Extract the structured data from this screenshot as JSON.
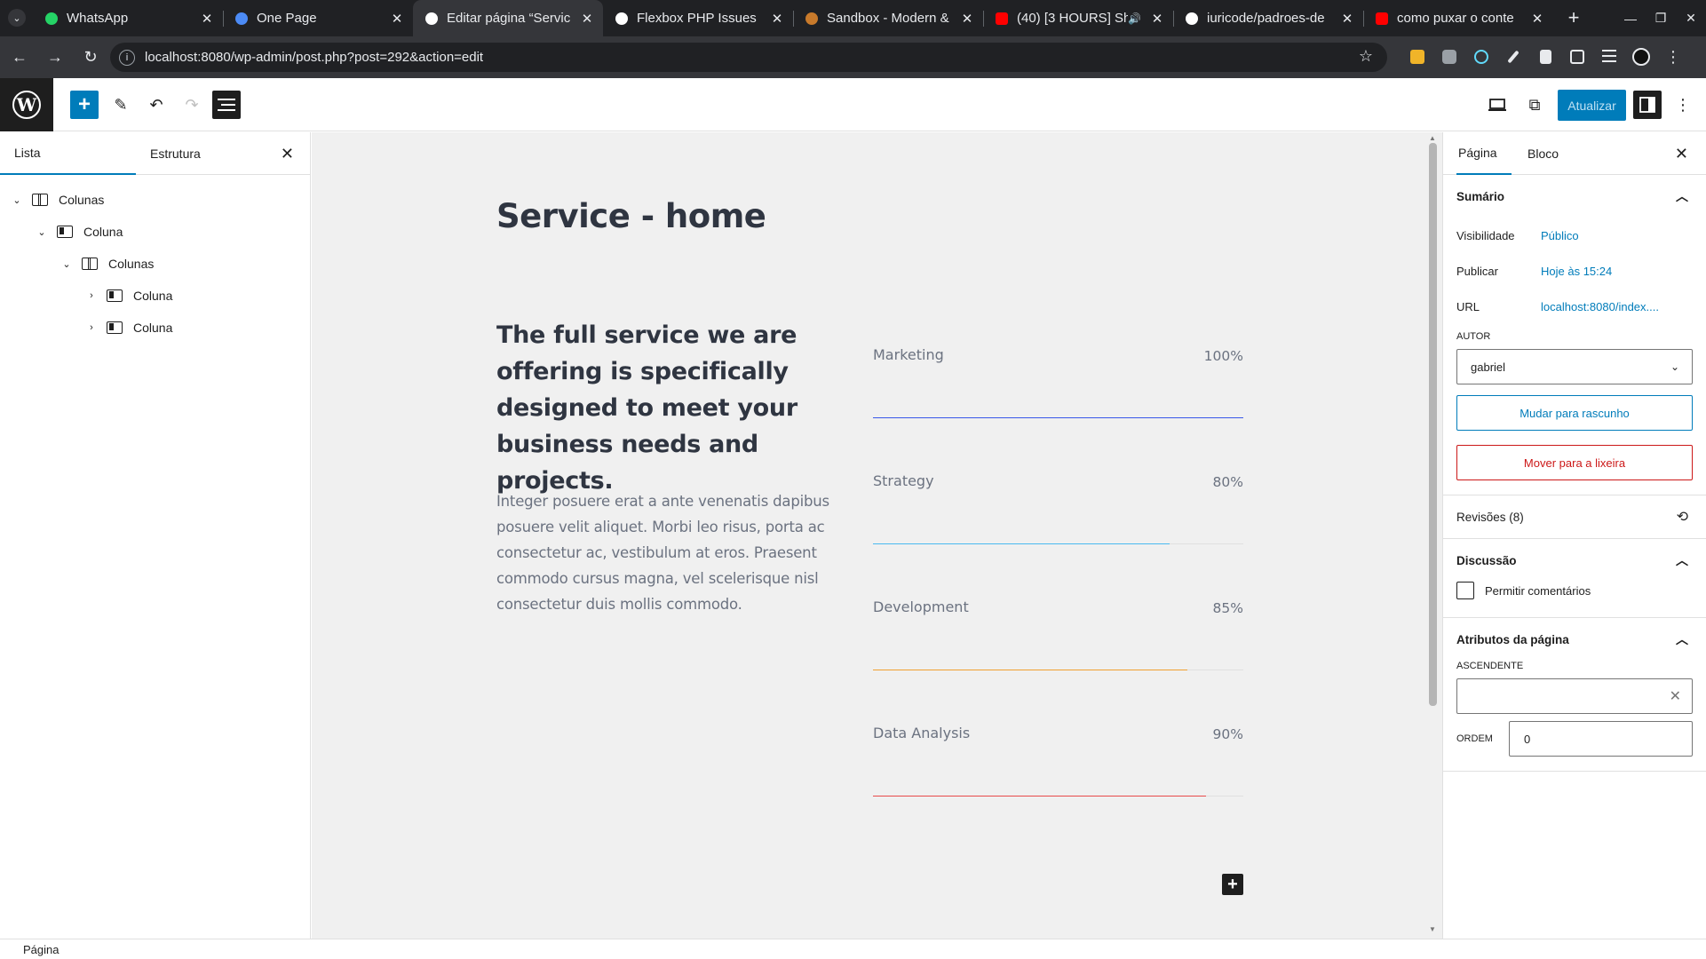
{
  "browser": {
    "tabs": [
      {
        "title": "WhatsApp",
        "icon": "whatsapp-icon",
        "color": "#25d366"
      },
      {
        "title": "One Page",
        "icon": "page-icon",
        "color": "#4c8bf5"
      },
      {
        "title": "Editar página “Servic",
        "icon": "wordpress-icon",
        "color": "#ffffff"
      },
      {
        "title": "Flexbox PHP Issues",
        "icon": "openai-icon",
        "color": "#ffffff"
      },
      {
        "title": "Sandbox - Modern &",
        "icon": "bookmark-icon",
        "color": "#c87a2b"
      },
      {
        "title": "(40) [3 HOURS] Sh",
        "icon": "youtube-icon",
        "color": "#ff0000"
      },
      {
        "title": "iuricode/padroes-de",
        "icon": "github-icon",
        "color": "#ffffff"
      },
      {
        "title": "como puxar o conte",
        "icon": "youtube-icon",
        "color": "#ff0000"
      }
    ],
    "url": "localhost:8080/wp-admin/post.php?post=292&action=edit"
  },
  "editor": {
    "update_label": "Atualizar"
  },
  "list_view": {
    "tabs": [
      "Lista",
      "Estrutura"
    ],
    "items": [
      {
        "label": "Colunas",
        "type": "cols",
        "chevron": "⌄",
        "indent": 0
      },
      {
        "label": "Coluna",
        "type": "col",
        "chevron": "⌄",
        "indent": 1
      },
      {
        "label": "Colunas",
        "type": "cols",
        "chevron": "⌄",
        "indent": 2
      },
      {
        "label": "Coluna",
        "type": "col",
        "chevron": "›",
        "indent": 3
      },
      {
        "label": "Coluna",
        "type": "col",
        "chevron": "›",
        "indent": 3
      }
    ]
  },
  "canvas": {
    "title": "Service - home",
    "lead": "The full service we are offering is specifically designed to meet your business needs and projects.",
    "body": "Integer posuere erat a ante venenatis dapibus posuere velit aliquet. Morbi leo risus, porta ac consectetur ac, vestibulum at eros. Praesent commodo cursus magna, vel scelerisque nisl consectetur duis mollis commodo.",
    "skills": [
      {
        "name": "Marketing",
        "percent_label": "100%",
        "value": 100,
        "color": "#3858e9"
      },
      {
        "name": "Strategy",
        "percent_label": "80%",
        "value": 80,
        "color": "#4ab9f0"
      },
      {
        "name": "Development",
        "percent_label": "85%",
        "value": 85,
        "color": "#f0a030"
      },
      {
        "name": "Data Analysis",
        "percent_label": "90%",
        "value": 90,
        "color": "#e84a4a"
      }
    ]
  },
  "sidebar": {
    "tabs": [
      "Página",
      "Bloco"
    ],
    "summary": {
      "heading": "Sumário",
      "visibility_label": "Visibilidade",
      "visibility_value": "Público",
      "publish_label": "Publicar",
      "publish_value": "Hoje às 15:24",
      "url_label": "URL",
      "url_value": "localhost:8080/index....",
      "author_label": "AUTOR",
      "author_value": "gabriel",
      "draft_button": "Mudar para rascunho",
      "trash_button": "Mover para a lixeira"
    },
    "revisions": "Revisões (8)",
    "discussion": {
      "heading": "Discussão",
      "allow_comments": "Permitir comentários"
    },
    "attributes": {
      "heading": "Atributos da página",
      "parent_label": "ASCENDENTE",
      "order_label": "ORDEM",
      "order_value": "0"
    }
  },
  "footer": {
    "breadcrumb": "Página"
  }
}
